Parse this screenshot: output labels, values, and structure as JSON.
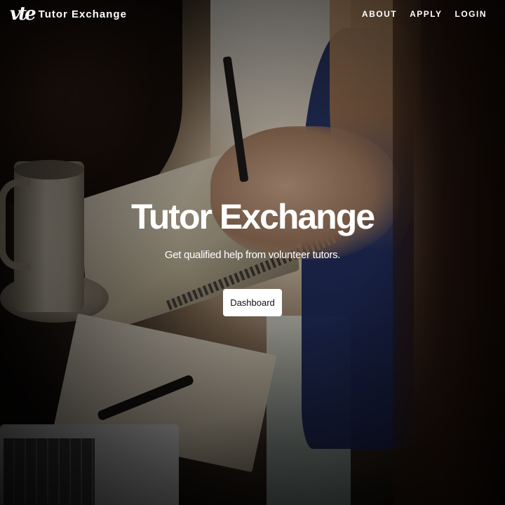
{
  "brand": {
    "logo_text": "vte",
    "name": "Tutor Exchange"
  },
  "nav": {
    "items": [
      {
        "label": "ABOUT"
      },
      {
        "label": "APPLY"
      },
      {
        "label": "LOGIN"
      }
    ]
  },
  "hero": {
    "title": "Tutor Exchange",
    "subtitle": "Get qualified help from volunteer tutors.",
    "button_label": "Dashboard"
  }
}
